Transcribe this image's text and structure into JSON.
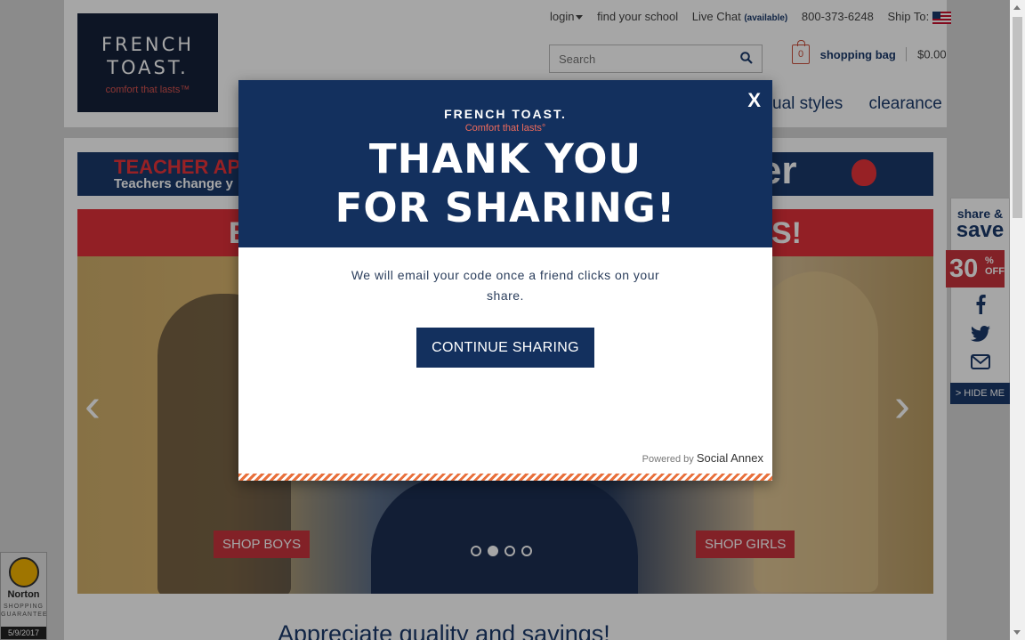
{
  "header": {
    "logo": {
      "line1": "FRENCH",
      "line2": "TOAST.",
      "tagline": "comfort that lasts™"
    },
    "utility": {
      "login": "login",
      "find_school": "find your school",
      "live_chat": "Live Chat",
      "available": "(available)",
      "phone": "800-373-6248",
      "ship_to": "Ship To:"
    },
    "search_placeholder": "Search",
    "bag": {
      "count": "0",
      "label": "shopping bag",
      "amount": "$0.00"
    },
    "nav": [
      "ual styles",
      "clearance"
    ]
  },
  "banner": {
    "title": "TEACHER AP",
    "subtitle": "Teachers change y",
    "right_text": "her"
  },
  "hero": {
    "heading_left": "E",
    "heading_right": "S!",
    "shop_boys": "SHOP BOYS",
    "shop_girls": "SHOP GIRLS",
    "active_slide_index": 1,
    "slide_count": 4
  },
  "below_fold": {
    "heading": "Appreciate quality and savings!"
  },
  "share_sidebar": {
    "line1": "share &",
    "line2": "save",
    "percent": "30",
    "percent_suffix": "%",
    "off": "OFF",
    "hide": "> HIDE ME"
  },
  "norton": {
    "brand": "Norton",
    "line1": "SHOPPING",
    "line2": "GUARANTEE",
    "date": "5/9/2017"
  },
  "modal": {
    "brand": "FRENCH TOAST.",
    "tagline": "Comfort that lasts°",
    "title_line1": "THANK YOU",
    "title_line2": "FOR SHARING!",
    "message": "We will email your code once a friend clicks on your share.",
    "button": "CONTINUE SHARING",
    "close": "X",
    "powered_by": "Powered by",
    "powered_brand": "Social Annex"
  },
  "colors": {
    "navy": "#13305e",
    "red": "#c8343d",
    "accent_orange": "#e8703c"
  }
}
